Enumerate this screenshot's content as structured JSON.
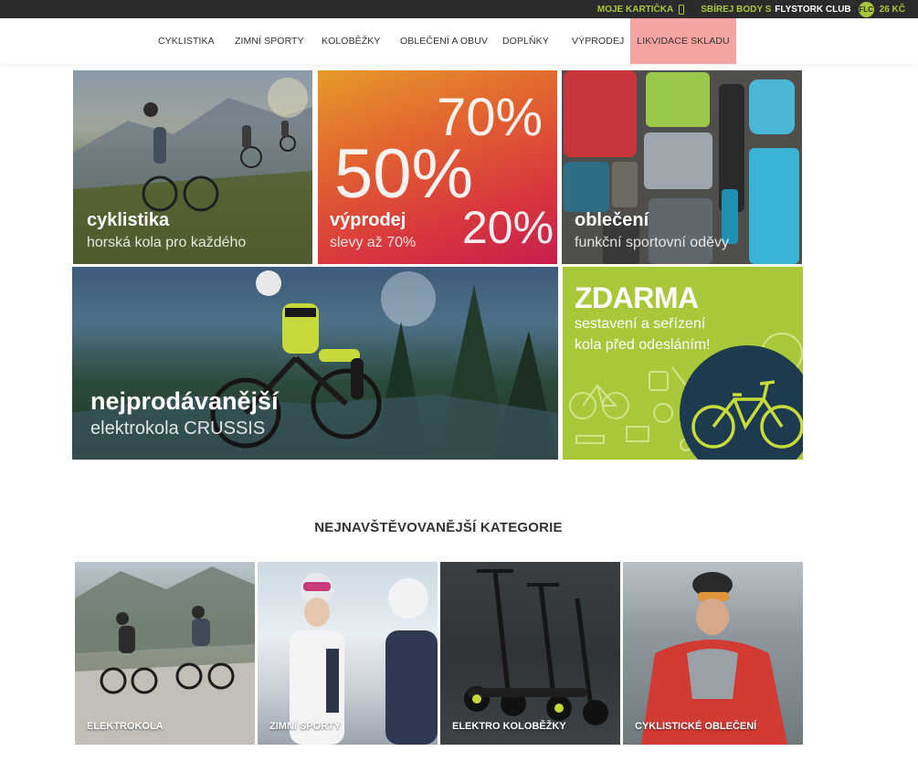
{
  "topbar": {
    "card_label": "MOJE KARTIČKA",
    "points_prefix": "SBÍREJ BODY S",
    "club_name": "FLYSTORK CLUB",
    "badge": "FLC",
    "points": "26 KČ"
  },
  "nav": {
    "items": [
      {
        "label": "CYKLISTIKA"
      },
      {
        "label": "ZIMNÍ SPORTY"
      },
      {
        "label": "KOLOBĚŽKY"
      },
      {
        "label": "OBLEČENÍ A OBUV"
      },
      {
        "label": "DOPLŇKY"
      },
      {
        "label": "VÝPRODEJ"
      },
      {
        "label": "LIKVIDACE SKLADU"
      }
    ],
    "highlight_color": "#f6a3a3"
  },
  "banners": {
    "cyklistika": {
      "title": "cyklistika",
      "subtitle": "horská kola pro každého"
    },
    "vyprodej": {
      "title": "výprodej",
      "subtitle": "slevy až 70%",
      "pct_a": "70%",
      "pct_b": "50%",
      "pct_c": "20%"
    },
    "obleceni": {
      "title": "oblečení",
      "subtitle": "funkční sportovní oděvy"
    },
    "ebike": {
      "title": "nejprodávanější",
      "subtitle": "elektrokola CRUSSIS"
    },
    "zdarma": {
      "title": "ZDARMA",
      "line1": "sestavení a seřízení",
      "line2": "kola před odesláním!",
      "accent": "#a8c83a"
    }
  },
  "section_heading": "NEJNAVŠTĚVOVANĚJŠÍ KATEGORIE",
  "categories": [
    {
      "label": "ELEKTROKOLA"
    },
    {
      "label": "ZIMNÍ SPORTY"
    },
    {
      "label": "ELEKTRO KOLOBĚŽKY"
    },
    {
      "label": "CYKLISTICKÉ OBLEČENÍ"
    }
  ]
}
